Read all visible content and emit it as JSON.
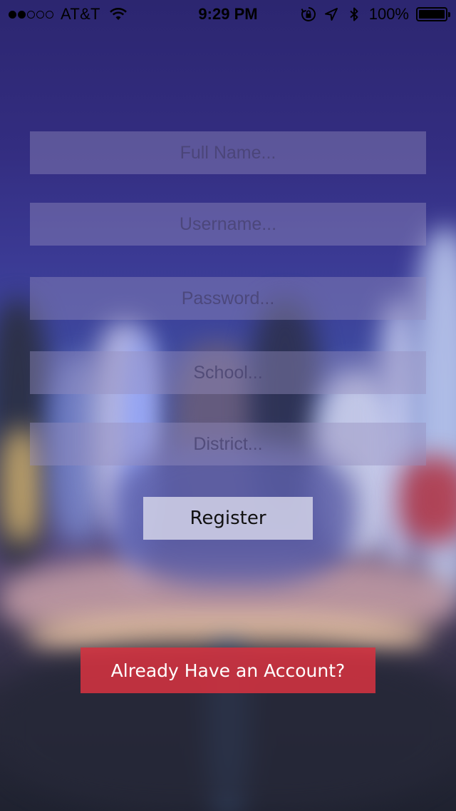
{
  "status_bar": {
    "signal_bars_filled": 2,
    "signal_bars_total": 5,
    "carrier": "AT&T",
    "wifi_icon": "wifi-icon",
    "time": "9:29 PM",
    "rotation_lock_icon": "rotation-lock-icon",
    "location_icon": "location-arrow-icon",
    "bluetooth_icon": "bluetooth-icon",
    "battery_percent": "100%",
    "battery_level": 1.0
  },
  "form": {
    "full_name": {
      "placeholder": "Full Name...",
      "value": ""
    },
    "username": {
      "placeholder": "Username...",
      "value": ""
    },
    "password": {
      "placeholder": "Password...",
      "value": ""
    },
    "school": {
      "placeholder": "School...",
      "value": ""
    },
    "district": {
      "placeholder": "District...",
      "value": ""
    },
    "register_label": "Register"
  },
  "account_link": {
    "label": "Already Have an Account?"
  },
  "colors": {
    "field_background": "#968ebe",
    "register_background": "#dedeee",
    "account_button_background": "#d43240",
    "background_top": "#2c2670"
  }
}
